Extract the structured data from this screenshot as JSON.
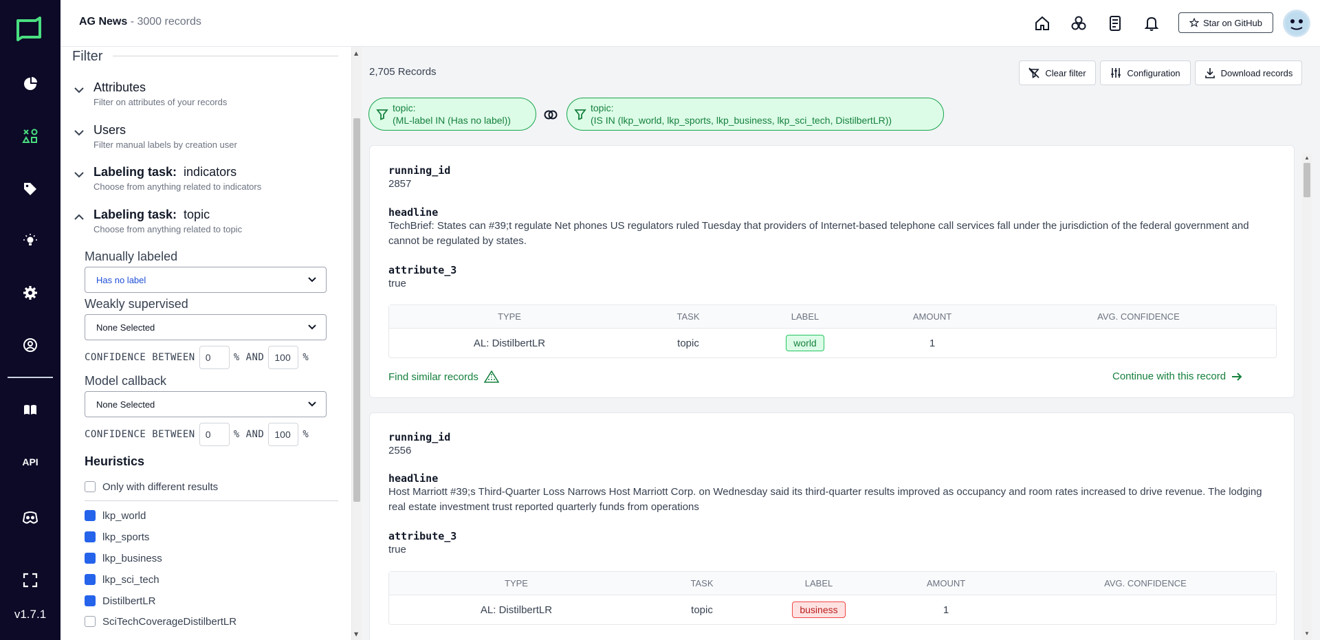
{
  "app": {
    "title": "AG News",
    "record_count": "3000 records",
    "version": "v1.7.1",
    "api_label": "API"
  },
  "header": {
    "star_button": "Star on GitHub"
  },
  "filter": {
    "title": "Filter",
    "sections": [
      {
        "title": "Attributes",
        "subtitle": "Filter on attributes of your records"
      },
      {
        "title": "Users",
        "subtitle": "Filter manual labels by creation user"
      },
      {
        "title_prefix": "Labeling task:",
        "title": "indicators",
        "subtitle": "Choose from anything related to indicators"
      },
      {
        "title_prefix": "Labeling task:",
        "title": "topic",
        "subtitle": "Choose from anything related to topic"
      }
    ],
    "manually_labeled": {
      "label": "Manually labeled",
      "value": "Has no label"
    },
    "weakly_supervised": {
      "label": "Weakly supervised",
      "value": "None Selected",
      "conf_prefix": "CONFIDENCE BETWEEN",
      "conf_min": "0",
      "conf_mid": "% AND",
      "conf_max": "100",
      "conf_suffix": "%"
    },
    "model_callback": {
      "label": "Model callback",
      "value": "None Selected",
      "conf_prefix": "CONFIDENCE BETWEEN",
      "conf_min": "0",
      "conf_mid": "% AND",
      "conf_max": "100",
      "conf_suffix": "%"
    },
    "heuristics": {
      "title": "Heuristics",
      "only_different": "Only with different results",
      "items": [
        {
          "name": "lkp_world",
          "checked": true
        },
        {
          "name": "lkp_sports",
          "checked": true
        },
        {
          "name": "lkp_business",
          "checked": true
        },
        {
          "name": "lkp_sci_tech",
          "checked": true
        },
        {
          "name": "DistilbertLR",
          "checked": true
        },
        {
          "name": "SciTechCoverageDistilbertLR",
          "checked": false
        }
      ]
    }
  },
  "main": {
    "records_count": "2,705 Records",
    "buttons": {
      "clear": "Clear filter",
      "config": "Configuration",
      "download": "Download records"
    },
    "chips": [
      {
        "line1": "topic:",
        "line2": "(ML-label IN (Has no label))"
      },
      {
        "line1": "topic:",
        "line2": "(IS IN (lkp_world, lkp_sports, lkp_business, lkp_sci_tech, DistilbertLR))"
      }
    ],
    "table_headers": [
      "TYPE",
      "TASK",
      "LABEL",
      "AMOUNT",
      "AVG. CONFIDENCE"
    ],
    "find_similar": "Find similar records",
    "continue": "Continue with this record",
    "records": [
      {
        "field1_name": "running_id",
        "field1_value": "2857",
        "field2_name": "headline",
        "field2_value": "TechBrief: States can #39;t regulate Net phones US regulators ruled Tuesday that providers of Internet-based telephone call services fall under the jurisdiction of the federal government and cannot be regulated by states.",
        "field3_name": "attribute_3",
        "field3_value": "true",
        "row": {
          "type": "AL: DistilbertLR",
          "task": "topic",
          "label": "world",
          "amount": "1",
          "conf": ""
        }
      },
      {
        "field1_name": "running_id",
        "field1_value": "2556",
        "field2_name": "headline",
        "field2_value": "Host Marriott #39;s Third-Quarter Loss Narrows Host Marriott Corp. on Wednesday said its third-quarter results improved as occupancy and room rates increased to drive revenue. The lodging real estate investment trust reported quarterly funds from operations",
        "field3_name": "attribute_3",
        "field3_value": "true",
        "row": {
          "type": "AL: DistilbertLR",
          "task": "topic",
          "label": "business",
          "amount": "1",
          "conf": ""
        }
      }
    ]
  },
  "colors": {
    "nav_bg": "#0c0a27",
    "accent_green": "#15803d",
    "check_blue": "#2563eb"
  }
}
